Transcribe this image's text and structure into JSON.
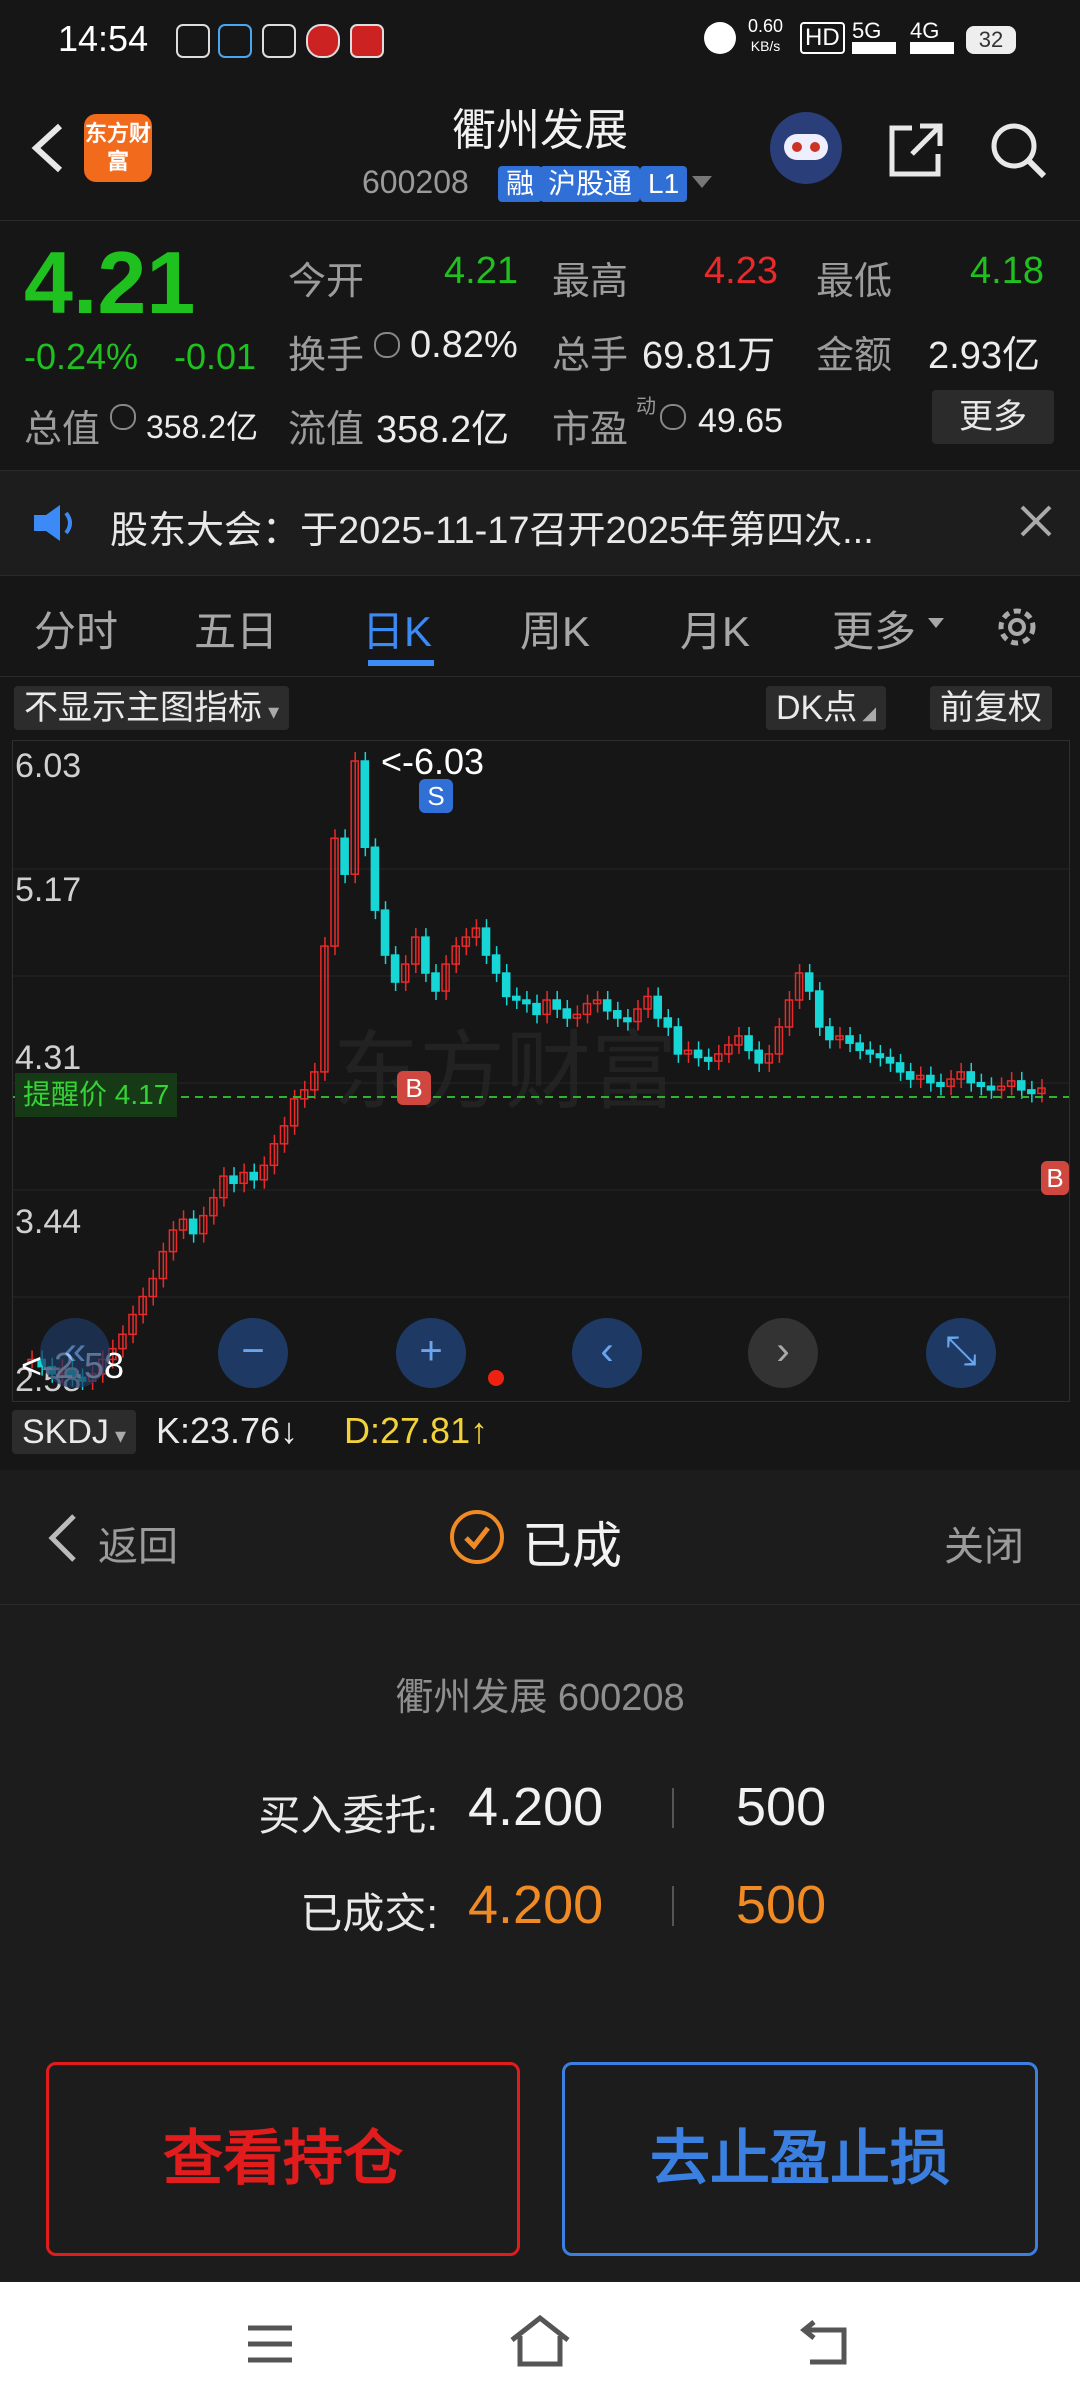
{
  "status_bar": {
    "time": "14:54",
    "net_speed": "0.60",
    "net_unit": "KB/s",
    "sig1": "5G",
    "sig2": "4G",
    "battery": "32"
  },
  "header": {
    "title": "衢州发展",
    "code": "600208",
    "tags": [
      "融",
      "沪股通",
      "L1"
    ],
    "logo_text": "东方财富"
  },
  "quote": {
    "price": "4.21",
    "change_pct": "-0.24%",
    "change_amt": "-0.01",
    "open_label": "今开",
    "open": "4.21",
    "high_label": "最高",
    "high": "4.23",
    "low_label": "最低",
    "low": "4.18",
    "turnover_label": "换手",
    "turnover": "0.82%",
    "volume_label": "总手",
    "volume": "69.81万",
    "amount_label": "金额",
    "amount": "2.93亿",
    "mcap_label": "总值",
    "mcap": "358.2亿",
    "float_label": "流值",
    "float_cap": "358.2亿",
    "pe_label": "市盈",
    "pe_sup": "动",
    "pe": "49.65",
    "more": "更多"
  },
  "notice": {
    "text": "股东大会：于2025-11-17召开2025年第四次..."
  },
  "tabs": [
    "分时",
    "五日",
    "日K",
    "周K",
    "月K",
    "更多"
  ],
  "chart_toolbar": {
    "indicator": "不显示主图指标",
    "dk": "DK点",
    "adjust": "前复权"
  },
  "chart_data": {
    "type": "candlestick",
    "y_ticks": [
      "6.03",
      "5.17",
      "4.31",
      "3.44",
      "2.58"
    ],
    "ylim": [
      2.58,
      6.03
    ],
    "max_label": "<-6.03",
    "min_label": "<-2.58",
    "alert_label": "提醒价 4.17",
    "alert_price": 4.17,
    "signals": [
      "S",
      "B",
      "B"
    ],
    "watermark": "东方财富"
  },
  "indicator_bar": {
    "name": "SKDJ",
    "k": "K:23.76",
    "k_arrow": "↓",
    "d": "D:27.81",
    "d_arrow": "↑"
  },
  "dialog": {
    "back": "返回",
    "status": "已成",
    "close": "关闭",
    "stock": "衢州发展 600208",
    "order_label": "买入委托:",
    "order_price": "4.200",
    "order_qty": "500",
    "filled_label": "已成交:",
    "filled_price": "4.200",
    "filled_qty": "500",
    "btn_position": "查看持仓",
    "btn_stop": "去止盈止损"
  },
  "colors": {
    "up": "#ea2a2a",
    "down": "#1fc11f",
    "accent": "#3b8af5",
    "filled": "#f08a24"
  }
}
